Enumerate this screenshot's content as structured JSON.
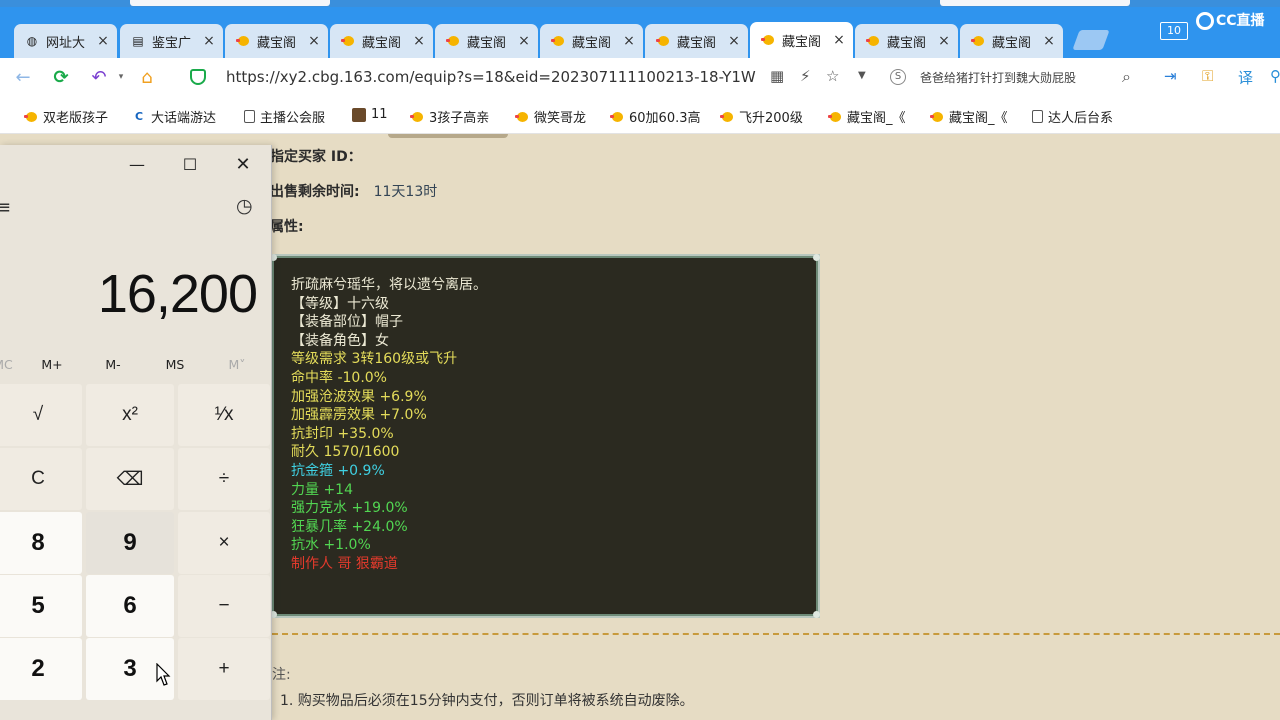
{
  "browser": {
    "tabs": [
      {
        "label": "网址大",
        "icon": "globe-icon"
      },
      {
        "label": "鉴宝广",
        "icon": "document-icon"
      },
      {
        "label": "藏宝阁",
        "icon": "chick-icon"
      },
      {
        "label": "藏宝阁",
        "icon": "chick-icon"
      },
      {
        "label": "藏宝阁",
        "icon": "chick-icon"
      },
      {
        "label": "藏宝阁",
        "icon": "chick-icon"
      },
      {
        "label": "藏宝阁",
        "icon": "chick-icon"
      },
      {
        "label": "藏宝阁",
        "icon": "chick-icon",
        "active": true
      },
      {
        "label": "藏宝阁",
        "icon": "chick-icon"
      },
      {
        "label": "藏宝阁",
        "icon": "chick-icon"
      }
    ],
    "tab_close": "×",
    "tab_count": "10",
    "brand": "CC直播",
    "url": "https://xy2.cbg.163.com/equip?s=18&eid=202307111100213-18-Y1W",
    "search_text": "爸爸给猪打针打到魏大勋屁股",
    "bookmarks": [
      {
        "label": "双老版孩子",
        "icon": "chick-icon"
      },
      {
        "label": "大话端游达",
        "icon": "c-logo-icon"
      },
      {
        "label": "主播公会服",
        "icon": "document-icon"
      },
      {
        "label": "11",
        "icon": "image-icon"
      },
      {
        "label": "3孩子高亲",
        "icon": "chick-icon"
      },
      {
        "label": "微笑哥龙",
        "icon": "chick-icon"
      },
      {
        "label": "60加60.3高",
        "icon": "chick-icon"
      },
      {
        "label": "飞升200级",
        "icon": "chick-icon"
      },
      {
        "label": "藏宝阁_《",
        "icon": "chick-icon"
      },
      {
        "label": "藏宝阁_《",
        "icon": "chick-icon"
      },
      {
        "label": "达人后台系",
        "icon": "document-icon"
      }
    ]
  },
  "page": {
    "buyer_label": "指定买家 ID：",
    "time_label": "出售剩余时间:",
    "time_value": "11天13时",
    "attr_label": "属性:",
    "attributes": [
      {
        "text": "折疏麻兮瑶华，将以遗兮离居。",
        "color": "white"
      },
      {
        "text": "【等级】十六级",
        "color": "white"
      },
      {
        "text": "【装备部位】帽子",
        "color": "white"
      },
      {
        "text": "【装备角色】女",
        "color": "white"
      },
      {
        "text": "等级需求 3转160级或飞升",
        "color": "yellow"
      },
      {
        "text": "命中率 -10.0%",
        "color": "yellow"
      },
      {
        "text": "加强沧波效果 +6.9%",
        "color": "yellow"
      },
      {
        "text": "加强霹雳效果 +7.0%",
        "color": "yellow"
      },
      {
        "text": "抗封印 +35.0%",
        "color": "yellow"
      },
      {
        "text": "耐久 1570/1600",
        "color": "yellow"
      },
      {
        "text": "抗金箍 +0.9%",
        "color": "cyan"
      },
      {
        "text": "力量 +14",
        "color": "green"
      },
      {
        "text": "强力克水 +19.0%",
        "color": "green"
      },
      {
        "text": "狂暴几率 +24.0%",
        "color": "green"
      },
      {
        "text": "抗水 +1.0%",
        "color": "green"
      },
      {
        "text": "制作人 哥 狠霸道",
        "color": "red"
      }
    ],
    "note_label": "注:",
    "note_1": "1. 购买物品后必须在15分钟内支付，否则订单将被系统自动废除。"
  },
  "calculator": {
    "display": "16,200",
    "memory": [
      "MC",
      "M+",
      "M-",
      "MS",
      "M˅"
    ],
    "keys": [
      {
        "label": "√",
        "kind": "op"
      },
      {
        "label": "x²",
        "kind": "op"
      },
      {
        "label": "¹⁄x",
        "kind": "op"
      },
      {
        "label": "C",
        "kind": "op"
      },
      {
        "label": "⌫",
        "kind": "op"
      },
      {
        "label": "÷",
        "kind": "op"
      },
      {
        "label": "8",
        "kind": "num"
      },
      {
        "label": "9",
        "kind": "num"
      },
      {
        "label": "×",
        "kind": "op"
      },
      {
        "label": "5",
        "kind": "num"
      },
      {
        "label": "6",
        "kind": "num"
      },
      {
        "label": "−",
        "kind": "op"
      },
      {
        "label": "2",
        "kind": "num"
      },
      {
        "label": "3",
        "kind": "num"
      },
      {
        "label": "+",
        "kind": "op"
      }
    ]
  }
}
